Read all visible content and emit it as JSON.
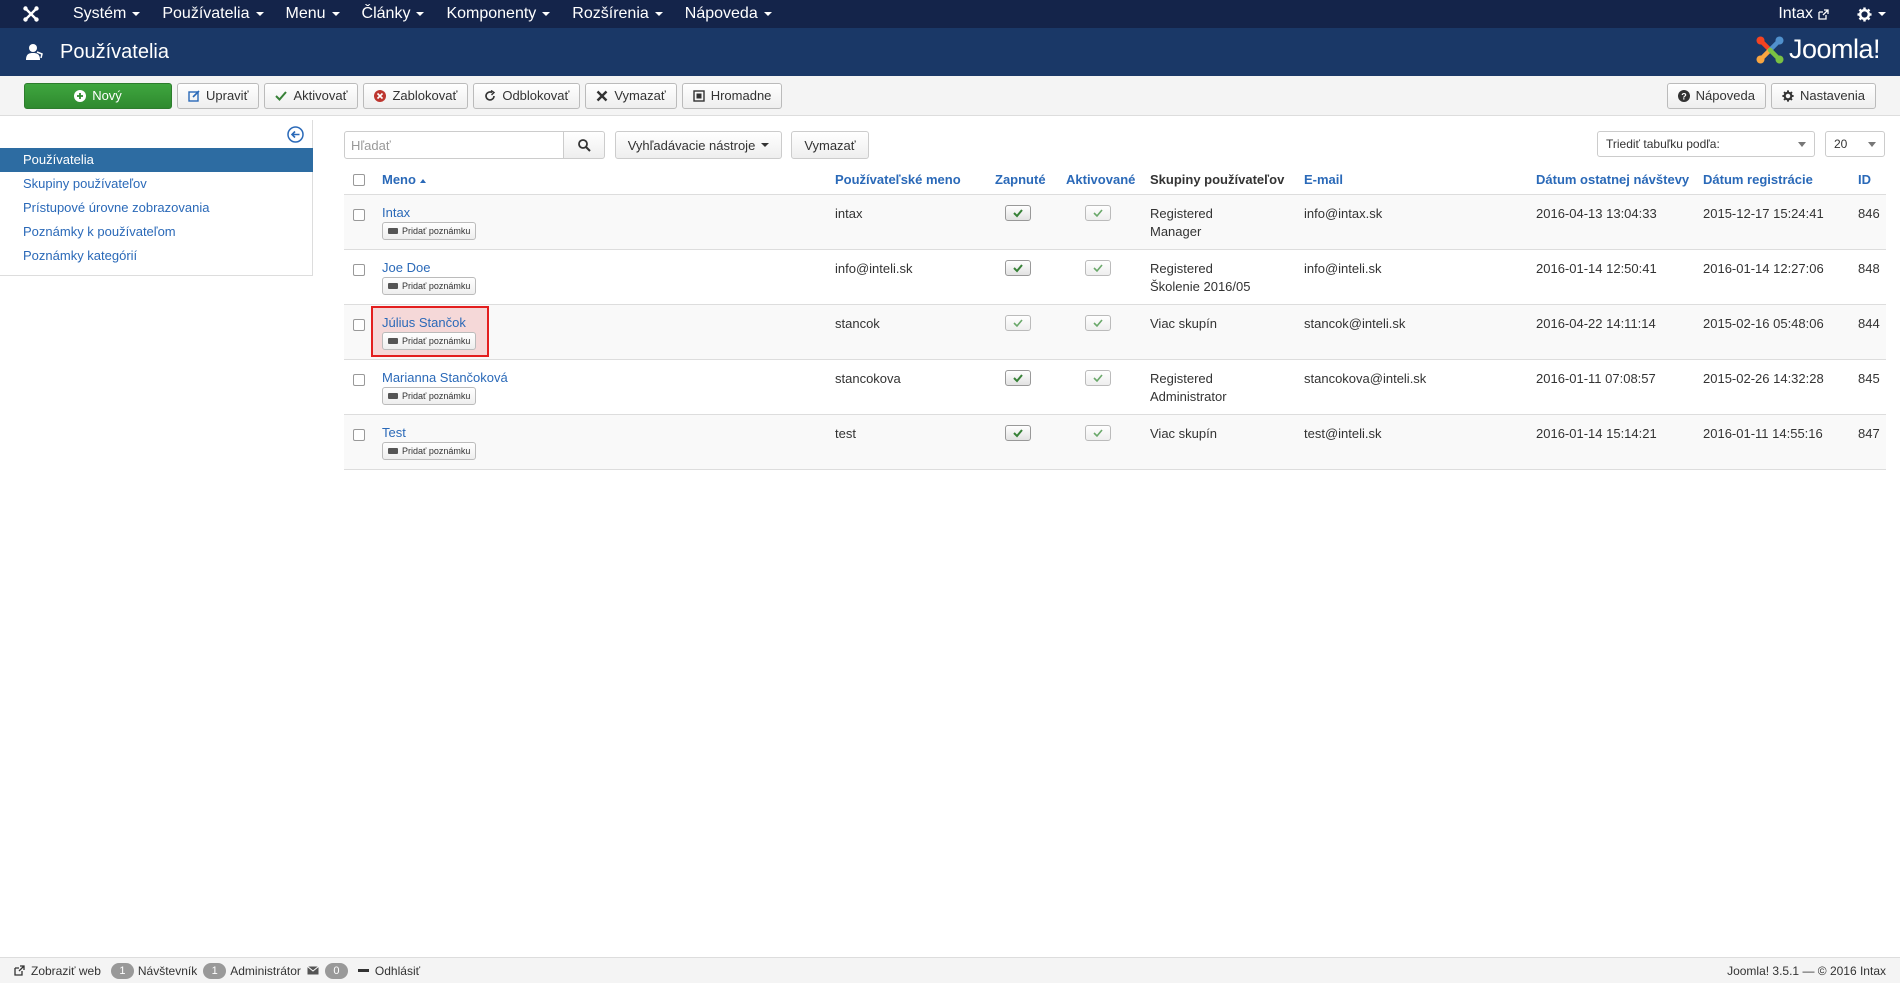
{
  "topnav": {
    "items": [
      "Systém",
      "Používatelia",
      "Menu",
      "Články",
      "Komponenty",
      "Rozšírenia",
      "Nápoveda"
    ],
    "site_link": "Intax"
  },
  "header": {
    "title": "Používatelia",
    "brand": "Joomla!"
  },
  "toolbar": {
    "new": "Nový",
    "edit": "Upraviť",
    "activate": "Aktivovať",
    "block": "Zablokovať",
    "unblock": "Odblokovať",
    "delete": "Vymazať",
    "batch": "Hromadne",
    "help": "Nápoveda",
    "options": "Nastavenia"
  },
  "sidebar": {
    "items": [
      {
        "label": "Používatelia",
        "active": true
      },
      {
        "label": "Skupiny používateľov"
      },
      {
        "label": "Prístupové úrovne zobrazovania"
      },
      {
        "label": "Poznámky k používateľom"
      },
      {
        "label": "Poznámky kategórií"
      }
    ]
  },
  "filters": {
    "search_placeholder": "Hľadať",
    "search_tools": "Vyhľadávacie nástroje",
    "clear": "Vymazať",
    "sort_label": "Triediť tabuľku podľa:",
    "limit": "20"
  },
  "table": {
    "headers": {
      "name": "Meno",
      "username": "Používateľské meno",
      "enabled": "Zapnuté",
      "activated": "Aktivované",
      "groups": "Skupiny používateľov",
      "email": "E-mail",
      "last_visit": "Dátum ostatnej návštevy",
      "registered": "Dátum registrácie",
      "id": "ID"
    },
    "add_note": "Pridať poznámku",
    "rows": [
      {
        "name": "Intax",
        "username": "intax",
        "enabled": true,
        "groups_line1": "Registered",
        "groups_line2": "Manager",
        "email": "info@intax.sk",
        "last_visit": "2016-04-13 13:04:33",
        "registered": "2015-12-17 15:24:41",
        "id": "846"
      },
      {
        "name": "Joe Doe",
        "username": "info@inteli.sk",
        "enabled": true,
        "groups_line1": "Registered",
        "groups_line2": "Školenie 2016/05",
        "email": "info@inteli.sk",
        "last_visit": "2016-01-14 12:50:41",
        "registered": "2016-01-14 12:27:06",
        "id": "848"
      },
      {
        "name": "Július Stančok",
        "username": "stancok",
        "enabled": false,
        "groups_line1": "Viac skupín",
        "groups_line2": "",
        "email": "stancok@inteli.sk",
        "last_visit": "2016-04-22 14:11:14",
        "registered": "2015-02-16 05:48:06",
        "id": "844",
        "highlighted": true
      },
      {
        "name": "Marianna Stančoková",
        "username": "stancokova",
        "enabled": true,
        "groups_line1": "Registered",
        "groups_line2": "Administrator",
        "email": "stancokova@inteli.sk",
        "last_visit": "2016-01-11 07:08:57",
        "registered": "2015-02-26 14:32:28",
        "id": "845"
      },
      {
        "name": "Test",
        "username": "test",
        "enabled": true,
        "groups_line1": "Viac skupín",
        "groups_line2": "",
        "email": "test@inteli.sk",
        "last_visit": "2016-01-14 15:14:21",
        "registered": "2016-01-11 14:55:16",
        "id": "847"
      }
    ]
  },
  "footer": {
    "view_site": "Zobraziť web",
    "visitors_count": "1",
    "visitors_label": "Návštevník",
    "admins_count": "1",
    "admins_label": "Administrátor",
    "messages_count": "0",
    "logout": "Odhlásiť",
    "version": "Joomla! 3.5.1 — © 2016 Intax"
  },
  "colors": {
    "navbar": "#14244a",
    "header": "#1a3867",
    "accent": "#2a69b8",
    "success": "#2f8a2f",
    "highlight": "#e31f1f"
  }
}
